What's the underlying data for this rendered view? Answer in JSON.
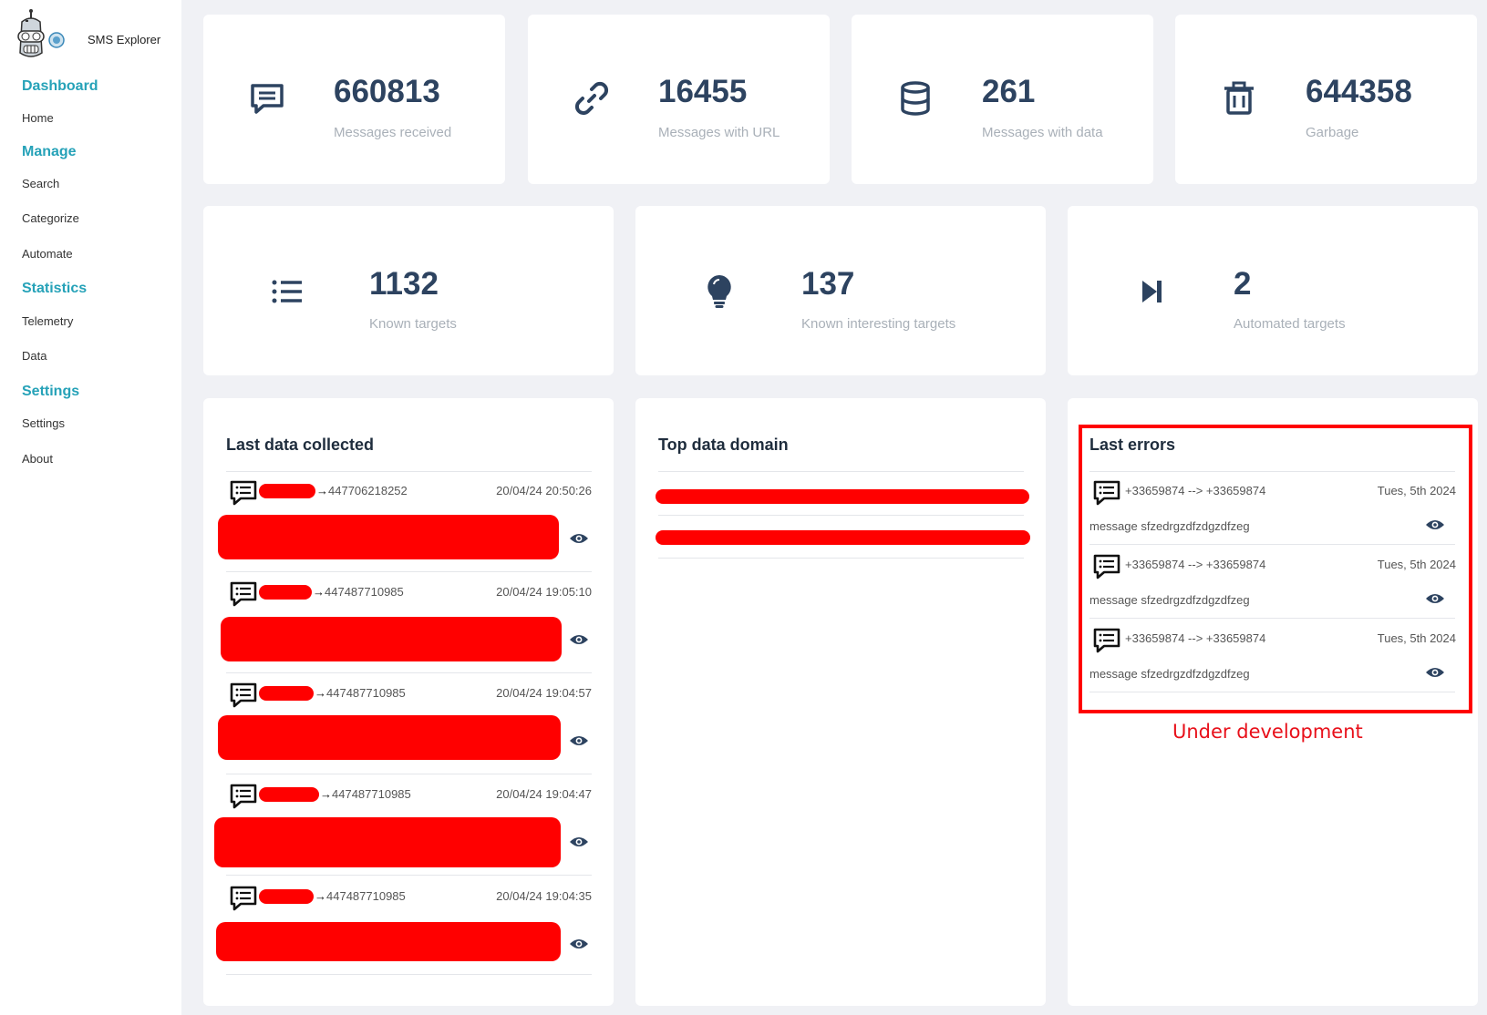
{
  "app": {
    "name": "SMS Explorer",
    "logo_icon": "robot-logo-icon"
  },
  "sidebar": {
    "groups": [
      {
        "title": "Dashboard",
        "items": [
          "Home"
        ]
      },
      {
        "title": "Manage",
        "items": [
          "Search",
          "Categorize",
          "Automate"
        ]
      },
      {
        "title": "Statistics",
        "items": [
          "Telemetry",
          "Data"
        ]
      },
      {
        "title": "Settings",
        "items": [
          "Settings",
          "About"
        ]
      }
    ]
  },
  "stats_top": [
    {
      "value": "660813",
      "label": "Messages received",
      "icon": "message-icon"
    },
    {
      "value": "16455",
      "label": "Messages with URL",
      "icon": "link-icon"
    },
    {
      "value": "261",
      "label": "Messages with data",
      "icon": "database-icon"
    },
    {
      "value": "644358",
      "label": "Garbage",
      "icon": "trash-icon"
    }
  ],
  "stats_mid": [
    {
      "value": "1132",
      "label": "Known targets",
      "icon": "list-icon"
    },
    {
      "value": "137",
      "label": "Known interesting targets",
      "icon": "lightbulb-icon"
    },
    {
      "value": "2",
      "label": "Automated targets",
      "icon": "skip-forward-icon"
    }
  ],
  "last_data": {
    "title": "Last data collected",
    "rows": [
      {
        "arrow": "→",
        "number": "447706218252",
        "datetime": "20/04/24 20:50:26"
      },
      {
        "arrow": "→",
        "number": "447487710985",
        "datetime": "20/04/24 19:05:10"
      },
      {
        "arrow": "→",
        "number": "447487710985",
        "datetime": "20/04/24 19:04:57"
      },
      {
        "arrow": "→",
        "number": "447487710985",
        "datetime": "20/04/24 19:04:47"
      },
      {
        "arrow": "→",
        "number": "447487710985",
        "datetime": "20/04/24 19:04:35"
      }
    ]
  },
  "top_domain": {
    "title": "Top data domain"
  },
  "last_errors": {
    "title": "Last errors",
    "rows": [
      {
        "route": "+33659874 --> +33659874",
        "date": "Tues, 5th 2024",
        "message": "message sfzedrgzdfzdgzdfzeg"
      },
      {
        "route": "+33659874 --> +33659874",
        "date": "Tues, 5th 2024",
        "message": "message sfzedrgzdfzdgzdfzeg"
      },
      {
        "route": "+33659874 --> +33659874",
        "date": "Tues, 5th 2024",
        "message": "message sfzedrgzdfzdgzdfzeg"
      }
    ],
    "annotation": "Under development"
  },
  "colors": {
    "accent": "#26a2b8",
    "value": "#2d4360",
    "redaction": "#ff0000"
  }
}
